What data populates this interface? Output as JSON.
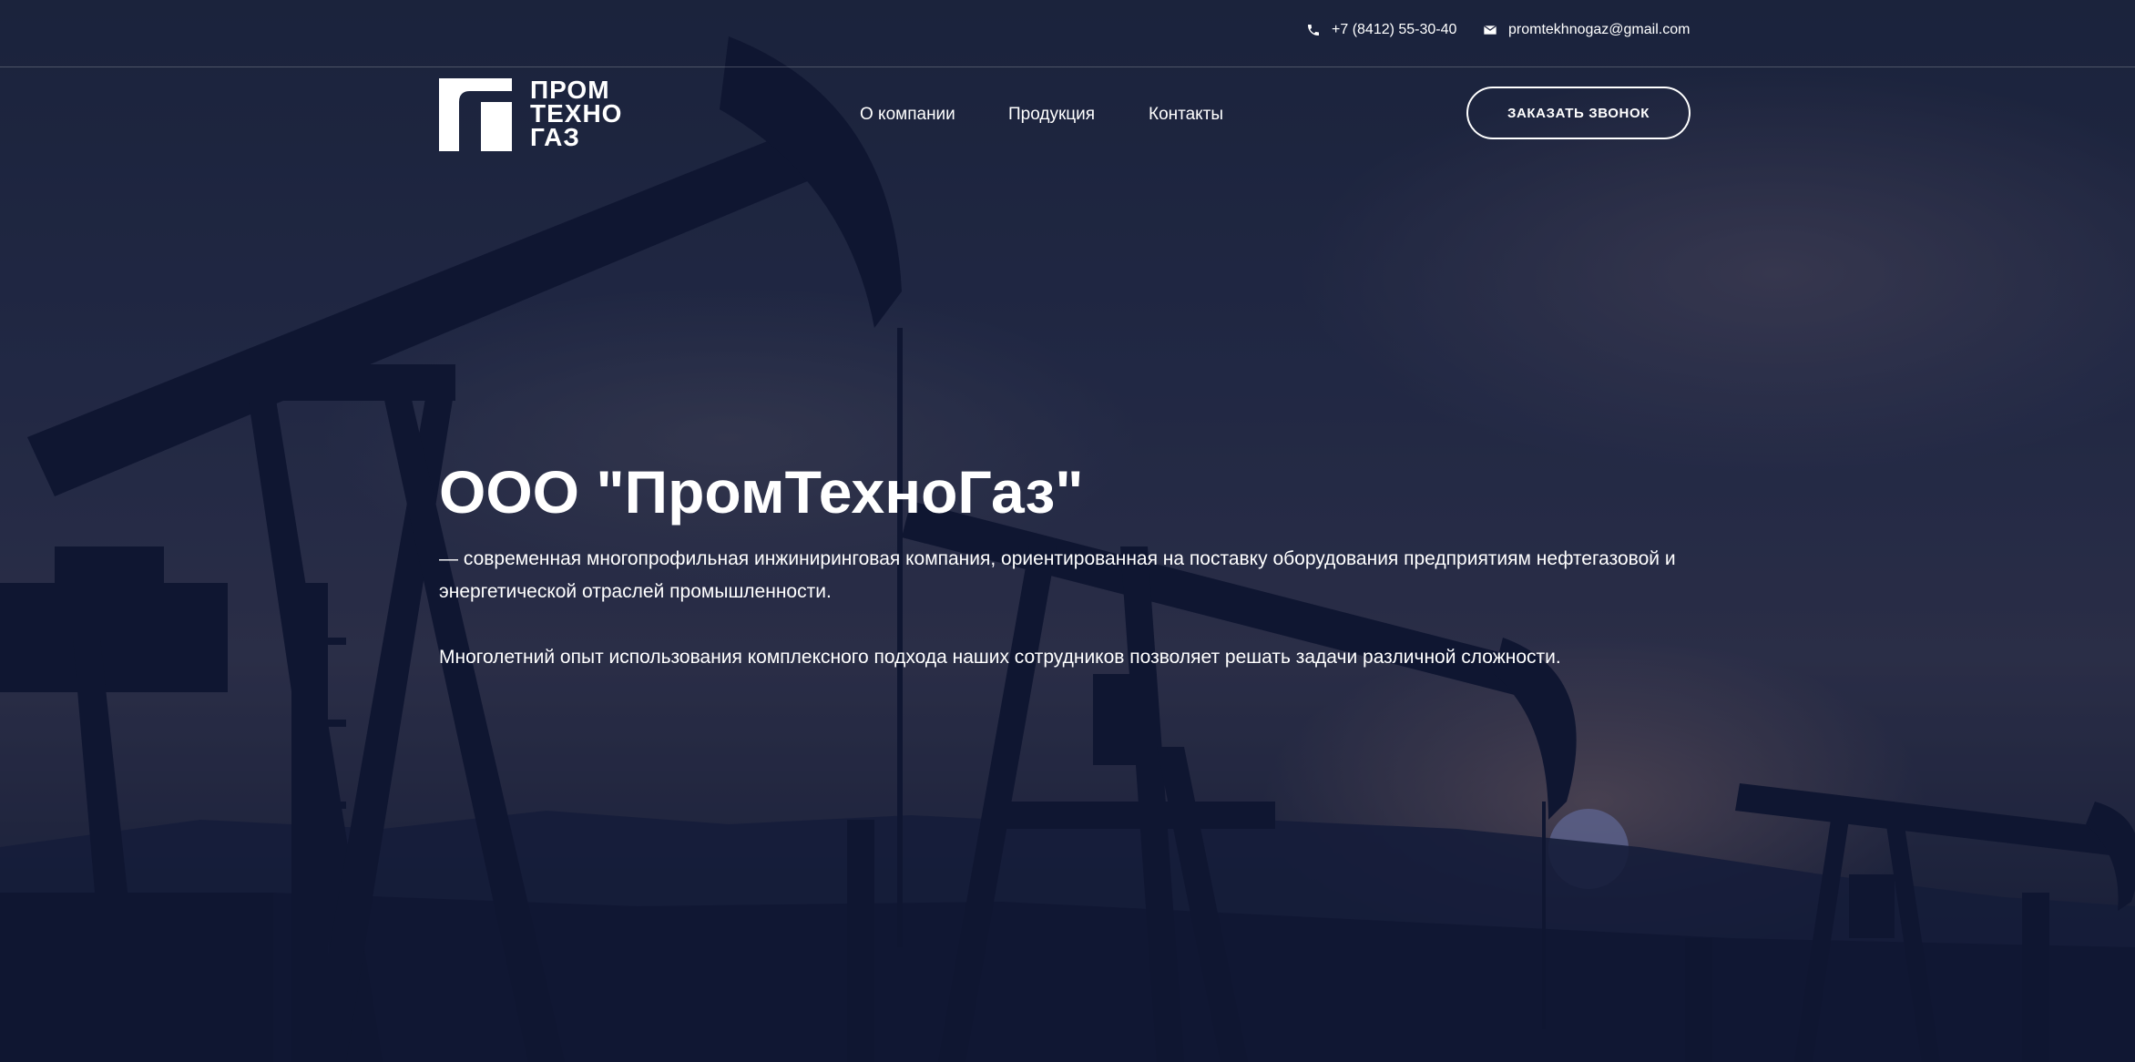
{
  "header": {
    "phone": "+7 (8412) 55-30-40",
    "email": "promtekhnogaz@gmail.com",
    "phone_icon": "phone-icon",
    "email_icon": "envelope-icon"
  },
  "logo": {
    "line1": "ПРОМ",
    "line2": "ТЕХНО",
    "line3": "ГАЗ"
  },
  "nav": {
    "items": [
      {
        "label": "О компании"
      },
      {
        "label": "Продукция"
      },
      {
        "label": "Контакты"
      }
    ]
  },
  "cta": {
    "label": "ЗАКАЗАТЬ ЗВОНОК"
  },
  "hero": {
    "title": "ООО \"ПромТехноГаз\"",
    "paragraph1": "— современная многопрофильная инжиниринговая компания, ориентированная на поставку оборудования предприятиям нефтегазовой и энергетической отраслей промышленности.",
    "paragraph2": "Многолетний опыт использования комплексного подхода наших сотрудников позволяет решать задачи различной сложности."
  },
  "colors": {
    "text": "#ffffff",
    "background": "#10172e",
    "silhouette": "#0f1630"
  }
}
